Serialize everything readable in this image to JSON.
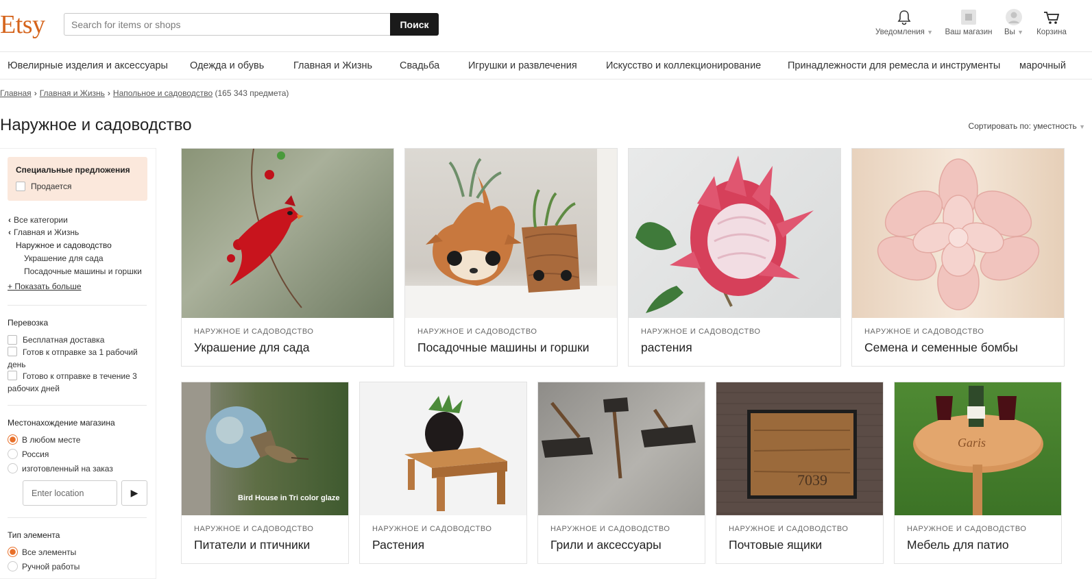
{
  "header": {
    "logo": "Etsy",
    "search_placeholder": "Search for items or shops",
    "search_button": "Поиск",
    "notifications": "Уведомления",
    "shop": "Ваш магазин",
    "you": "Вы",
    "cart": "Корзина"
  },
  "nav": {
    "items": [
      "Ювелирные изделия и аксессуары",
      "Одежда и обувь",
      "Главная и Жизнь",
      "Свадьба",
      "Игрушки и развлечения",
      "Искусство и коллекционирование",
      "Принадлежности для ремесла и инструменты",
      "марочный"
    ]
  },
  "breadcrumb": {
    "home": "Главная",
    "home_living": "Главная и Жизнь",
    "current": "Напольное и садоводство",
    "count": "(165 343 предмета)"
  },
  "page": {
    "title": "Наружное и садоводство",
    "sort_label": "Сортировать по: уместность"
  },
  "sidebar": {
    "special_title": "Специальные предложения",
    "on_sale": "Продается",
    "tree": {
      "all_categories": "Все категории",
      "home_living": "Главная и Жизнь",
      "current": "Наружное и садоводство",
      "sub1": "Украшение для сада",
      "sub2": "Посадочные машины и горшки",
      "show_more": "+ Показать больше"
    },
    "shipping_title": "Перевозка",
    "free_shipping": "Бесплатная доставка",
    "ready_1day": "Готов к отправке за 1 рабочий день",
    "ready_3days": "Готово к отправке в течение 3 рабочих дней",
    "location_title": "Местонахождение магазина",
    "loc_anywhere": "В любом месте",
    "loc_russia": "Россия",
    "loc_custom": "изготовленный на заказ",
    "loc_placeholder": "Enter location",
    "type_title": "Тип элемента",
    "type_all": "Все элементы",
    "type_handmade": "Ручной работы"
  },
  "cards_row1": [
    {
      "category": "НАРУЖНОЕ И САДОВОДСТВО",
      "title": "Украшение для сада"
    },
    {
      "category": "НАРУЖНОЕ И САДОВОДСТВО",
      "title": "Посадочные машины и горшки"
    },
    {
      "category": "НАРУЖНОЕ И САДОВОДСТВО",
      "title": "растения"
    },
    {
      "category": "НАРУЖНОЕ И САДОВОДСТВО",
      "title": "Семена и семенные бомбы"
    }
  ],
  "cards_row2": [
    {
      "category": "НАРУЖНОЕ И САДОВОДСТВО",
      "title": "Питатели и птичники",
      "overlay": "Bird House in Tri color glaze"
    },
    {
      "category": "НАРУЖНОЕ И САДОВОДСТВО",
      "title": "Растения"
    },
    {
      "category": "НАРУЖНОЕ И САДОВОДСТВО",
      "title": "Грили и аксессуары"
    },
    {
      "category": "НАРУЖНОЕ И САДОВОДСТВО",
      "title": "Почтовые ящики",
      "mailbox_number": "7039"
    },
    {
      "category": "НАРУЖНОЕ И САДОВОДСТВО",
      "title": "Мебель для патио",
      "table_engraving": "Garis"
    }
  ],
  "colors": {
    "brand": "#d5641c",
    "special_bg": "#fbe8dc",
    "radio_active": "#e8702a",
    "search_button": "#1a1a1a"
  }
}
